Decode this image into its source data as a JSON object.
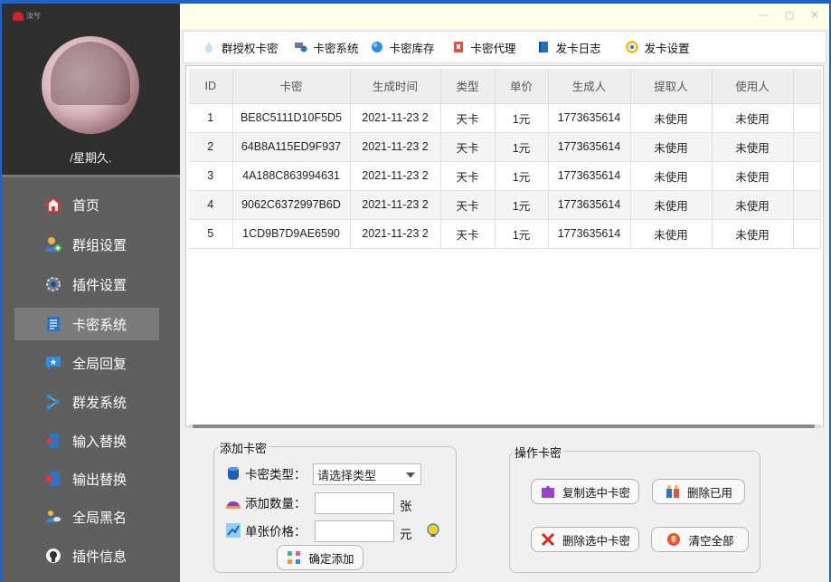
{
  "sidebar": {
    "logo_text": "汝兮",
    "username": "/星期久.",
    "items": [
      {
        "label": "首页",
        "icon": "home-icon"
      },
      {
        "label": "群组设置",
        "icon": "users-icon"
      },
      {
        "label": "插件设置",
        "icon": "gear-icon"
      },
      {
        "label": "卡密系统",
        "icon": "document-icon",
        "active": true
      },
      {
        "label": "全局回复",
        "icon": "chat-icon"
      },
      {
        "label": "群发系统",
        "icon": "share-icon"
      },
      {
        "label": "输入替换",
        "icon": "input-icon"
      },
      {
        "label": "输出替换",
        "icon": "output-icon"
      },
      {
        "label": "全局黑名",
        "icon": "blacklist-icon"
      },
      {
        "label": "插件信息",
        "icon": "github-icon"
      }
    ]
  },
  "toolbar": {
    "items": [
      {
        "label": "群授权卡密",
        "icon": "drop-icon"
      },
      {
        "label": "卡密系统",
        "icon": "key-system-icon"
      },
      {
        "label": "卡密库存",
        "icon": "globe-icon"
      },
      {
        "label": "卡密代理",
        "icon": "agent-icon"
      },
      {
        "label": "发卡日志",
        "icon": "book-icon"
      },
      {
        "label": "发卡设置",
        "icon": "settings-ring-icon"
      }
    ]
  },
  "table": {
    "columns": [
      "ID",
      "卡密",
      "生成时间",
      "类型",
      "单价",
      "生成人",
      "提取人",
      "使用人"
    ],
    "rows": [
      [
        "1",
        "BE8C5111D10F5D5",
        "2021-11-23 2",
        "天卡",
        "1元",
        "1773635614",
        "未使用",
        "未使用"
      ],
      [
        "2",
        "64B8A115ED9F937",
        "2021-11-23 2",
        "天卡",
        "1元",
        "1773635614",
        "未使用",
        "未使用"
      ],
      [
        "3",
        "4A188C863994631",
        "2021-11-23 2",
        "天卡",
        "1元",
        "1773635614",
        "未使用",
        "未使用"
      ],
      [
        "4",
        "9062C6372997B6D",
        "2021-11-23 2",
        "天卡",
        "1元",
        "1773635614",
        "未使用",
        "未使用"
      ],
      [
        "5",
        "1CD9B7D9AE6590",
        "2021-11-23 2",
        "天卡",
        "1元",
        "1773635614",
        "未使用",
        "未使用"
      ]
    ]
  },
  "add_group": {
    "title": "添加卡密",
    "type_label": "卡密类型：",
    "type_value": "请选择类型",
    "count_label": "添加数量：",
    "count_unit": "张",
    "price_label": "单张价格：",
    "price_unit": "元",
    "confirm_label": "确定添加"
  },
  "ops_group": {
    "title": "操作卡密",
    "copy_label": "复制选中卡密",
    "delete_used_label": "删除已用",
    "delete_selected_label": "删除选中卡密",
    "clear_all_label": "清空全部"
  }
}
